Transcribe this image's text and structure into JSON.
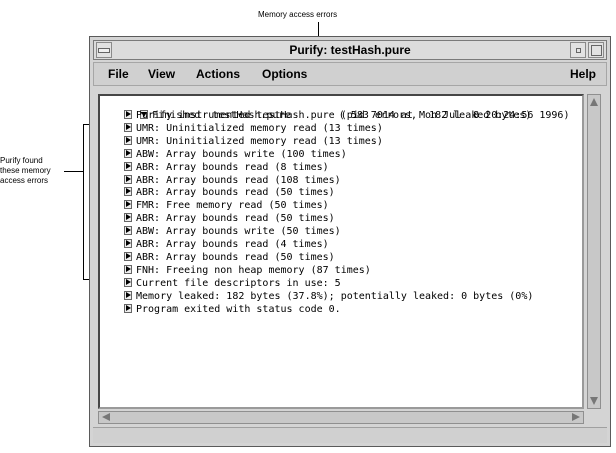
{
  "annotations": {
    "top_label": "Memory access errors",
    "left_label_lines": [
      "Purify found",
      "these memory",
      "access errors"
    ]
  },
  "window": {
    "title": "Purify: testHash.pure",
    "menu": {
      "file": "File",
      "view": "View",
      "actions": "Actions",
      "options": "Options",
      "help": "Help"
    }
  },
  "log": {
    "header": "Finished  testHash.pure        ( 583 errors,  182 leaked bytes)",
    "items": [
      "Purify instrumented testHash.pure (pid 7014 at Mon Jul  8 20:24:56 1996)",
      "UMR: Uninitialized memory read (13 times)",
      "UMR: Uninitialized memory read (13 times)",
      "ABW: Array bounds write (100 times)",
      "ABR: Array bounds read (8 times)",
      "ABR: Array bounds read (108 times)",
      "ABR: Array bounds read (50 times)",
      "FMR: Free memory read (50 times)",
      "ABR: Array bounds read (50 times)",
      "ABW: Array bounds write (50 times)",
      "ABR: Array bounds read (4 times)",
      "ABR: Array bounds read (50 times)",
      "FNH: Freeing non heap memory (87 times)",
      "Current file descriptors in use: 5",
      "Memory leaked: 182 bytes (37.8%); potentially leaked: 0 bytes (0%)",
      "Program exited with status code 0."
    ]
  },
  "icons": {
    "menu": "window-menu-icon",
    "minimize": "minimize-icon",
    "maximize": "maximize-icon",
    "expand": "expand-triangle-icon",
    "collapse": "collapse-triangle-icon"
  }
}
